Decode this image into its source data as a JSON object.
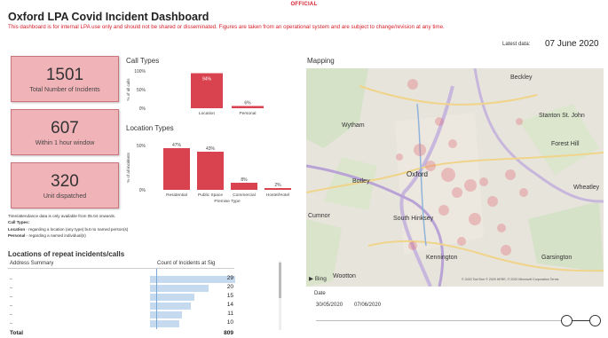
{
  "header": {
    "official": "OFFICIAL",
    "title": "Oxford LPA Covid Incident Dashboard",
    "subtitle": "This dashboard is for internal LPA use only and should not be shared or disseminated. Figures are taken from an operational system and are subject to change/revision at any time.",
    "latest_label": "Latest data:",
    "latest_value": "07 June 2020"
  },
  "kpis": [
    {
      "value": "1501",
      "label": "Total Number of Incidents"
    },
    {
      "value": "607",
      "label": "Within 1 hour window"
    },
    {
      "value": "320",
      "label": "Unit dispatched"
    }
  ],
  "notes": {
    "line1": "Time/attendance data is only available from 05.04 onwards.",
    "call_types_heading": "Call Types:",
    "location_term": "Location",
    "location_desc": " - regarding a location (any type) but no named person(s)",
    "personal_term": "Personal",
    "personal_desc": " - regarding a named individual(s)"
  },
  "sections": {
    "call_types": "Call Types",
    "location_types": "Location Types",
    "mapping": "Mapping",
    "repeat": "Locations of repeat incidents/calls"
  },
  "chart_data": [
    {
      "type": "bar",
      "title": "Call Types",
      "categories": [
        "Location",
        "Personal"
      ],
      "values": [
        94,
        6
      ],
      "data_labels": [
        "94%",
        "6%"
      ],
      "ylabel": "% of all calls",
      "yticks": [
        "100%",
        "50%",
        "0%"
      ],
      "ylim": [
        0,
        100
      ],
      "color": "#d9434f"
    },
    {
      "type": "bar",
      "title": "Location Types",
      "categories": [
        "Residential",
        "Public Space",
        "Commercial",
        "Hostel/Hotel"
      ],
      "values": [
        47,
        43,
        8,
        2
      ],
      "data_labels": [
        "47%",
        "43%",
        "8%",
        "2%"
      ],
      "xlabel": "Premise Type",
      "ylabel": "% of all incidents",
      "yticks": [
        "50%",
        "0%"
      ],
      "ylim": [
        0,
        50
      ],
      "color": "#d9434f"
    }
  ],
  "table": {
    "col1": "Address Summary",
    "col2": "Count of Incidents at Sig",
    "values": [
      "29",
      "20",
      "15",
      "14",
      "11",
      "10"
    ],
    "total_label": "Total",
    "total_value": "809"
  },
  "map": {
    "labels": {
      "beckley": "Beckley",
      "wytham": "Wytham",
      "stanton": "Stanton St. John",
      "forest_hill": "Forest Hill",
      "oxford": "Oxford",
      "botley": "Botley",
      "wheatley": "Wheatley",
      "cumnor": "Cumnor",
      "south_hinksey": "South Hinksey",
      "kennington": "Kennington",
      "garsington": "Garsington",
      "wootton": "Wootton"
    },
    "bing": "Bing",
    "copyright": "© 2020 TomTom © 2020 HERE, © 2020 Microsoft Corporation  Terms"
  },
  "date_filter": {
    "label": "Date",
    "start": "30/05/2020",
    "end": "07/06/2020"
  }
}
